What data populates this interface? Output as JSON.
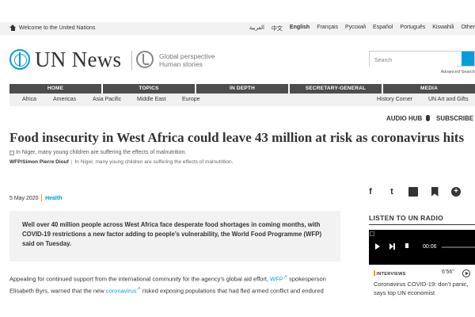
{
  "topbar": {
    "welcome": "Welcome to the United Nations",
    "languages": [
      "العربية",
      "中文",
      "English",
      "Français",
      "Русский",
      "Español",
      "Português",
      "Kiswahili",
      "Other"
    ],
    "active_language": "English"
  },
  "header": {
    "brand": "UN News",
    "tagline_line1": "Global perspective",
    "tagline_line2": "Human stories",
    "search_placeholder": "Search",
    "advanced_search": "Advanced Search"
  },
  "nav": {
    "items": [
      "HOME",
      "TOPICS",
      "IN DEPTH",
      "SECRETARY-GENERAL",
      "MEDIA"
    ],
    "sub_items": [
      "Africa",
      "Americas",
      "Asia Pacific",
      "Middle East",
      "Europe",
      "History Corner",
      "UN Art and Gifts"
    ]
  },
  "article": {
    "audio_hub": "AUDIO HUB",
    "subscribe": "SUBSCRIBE",
    "headline": "Food insecurity in West Africa could leave 43 million at risk as coronavirus hits",
    "image_alt": "In Niger, many young children are suffering the effects of malnutrition.",
    "credit": "WFP/Simon Pierre Diouf",
    "caption": "In Niger, many young children are suffering the effects of malnutrition.",
    "date": "5 May 2020",
    "category": "Health",
    "lede": "Well over 40 million people across West Africa face desperate food shortages in coming months, with COVID-19 restrictions a new factor adding to people’s vulnerability, the World Food Programme (WFP) said on Tuesday.",
    "body_1": "Appealing for continued support from the international community for the agency’s global aid effort,",
    "body_link_1": "WFP",
    "body_2": "spokesperson Elisabeth Byrs, warned that the new",
    "body_link_2": "coronavirus",
    "body_3": "risked exposing populations that had fled armed conflict and endured"
  },
  "share": {
    "facebook": "f",
    "twitter": "t"
  },
  "radio": {
    "title": "LISTEN TO UN RADIO",
    "time": "00:06",
    "category": "INTERVIEWS",
    "duration": "6’56\"",
    "item_title": "Coronavirus COVID-19: don’t panic, says top UN economist"
  }
}
